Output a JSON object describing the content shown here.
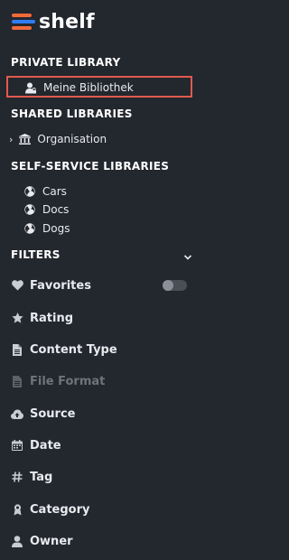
{
  "app": {
    "logo_text": "shelf",
    "brand_colors": [
      "#f06a3a",
      "#2f7df6"
    ]
  },
  "private": {
    "title": "PRIVATE LIBRARY",
    "items": [
      {
        "label": "Meine Bibliothek",
        "icon": "user-lock-icon",
        "selected": true
      }
    ]
  },
  "shared": {
    "title": "SHARED LIBRARIES",
    "items": [
      {
        "label": "Organisation",
        "icon": "building-icon"
      }
    ]
  },
  "selfservice": {
    "title": "SELF-SERVICE LIBRARIES",
    "items": [
      {
        "label": "Cars",
        "icon": "globe-icon"
      },
      {
        "label": "Docs",
        "icon": "globe-icon"
      },
      {
        "label": "Dogs",
        "icon": "globe-icon"
      }
    ]
  },
  "filters": {
    "title": "FILTERS",
    "items": [
      {
        "label": "Favorites",
        "icon": "heart-icon",
        "toggle_on": false
      },
      {
        "label": "Rating",
        "icon": "star-icon"
      },
      {
        "label": "Content Type",
        "icon": "file-icon"
      },
      {
        "label": "File Format",
        "icon": "file-icon",
        "disabled": true
      },
      {
        "label": "Source",
        "icon": "cloud-upload-icon"
      },
      {
        "label": "Date",
        "icon": "calendar-icon"
      },
      {
        "label": "Tag",
        "icon": "hashtag-icon"
      },
      {
        "label": "Category",
        "icon": "category-icon"
      },
      {
        "label": "Owner",
        "icon": "user-icon"
      }
    ]
  },
  "colors": {
    "background": "#23272e",
    "selection_border": "#e05a4f",
    "muted": "#6e747c"
  }
}
